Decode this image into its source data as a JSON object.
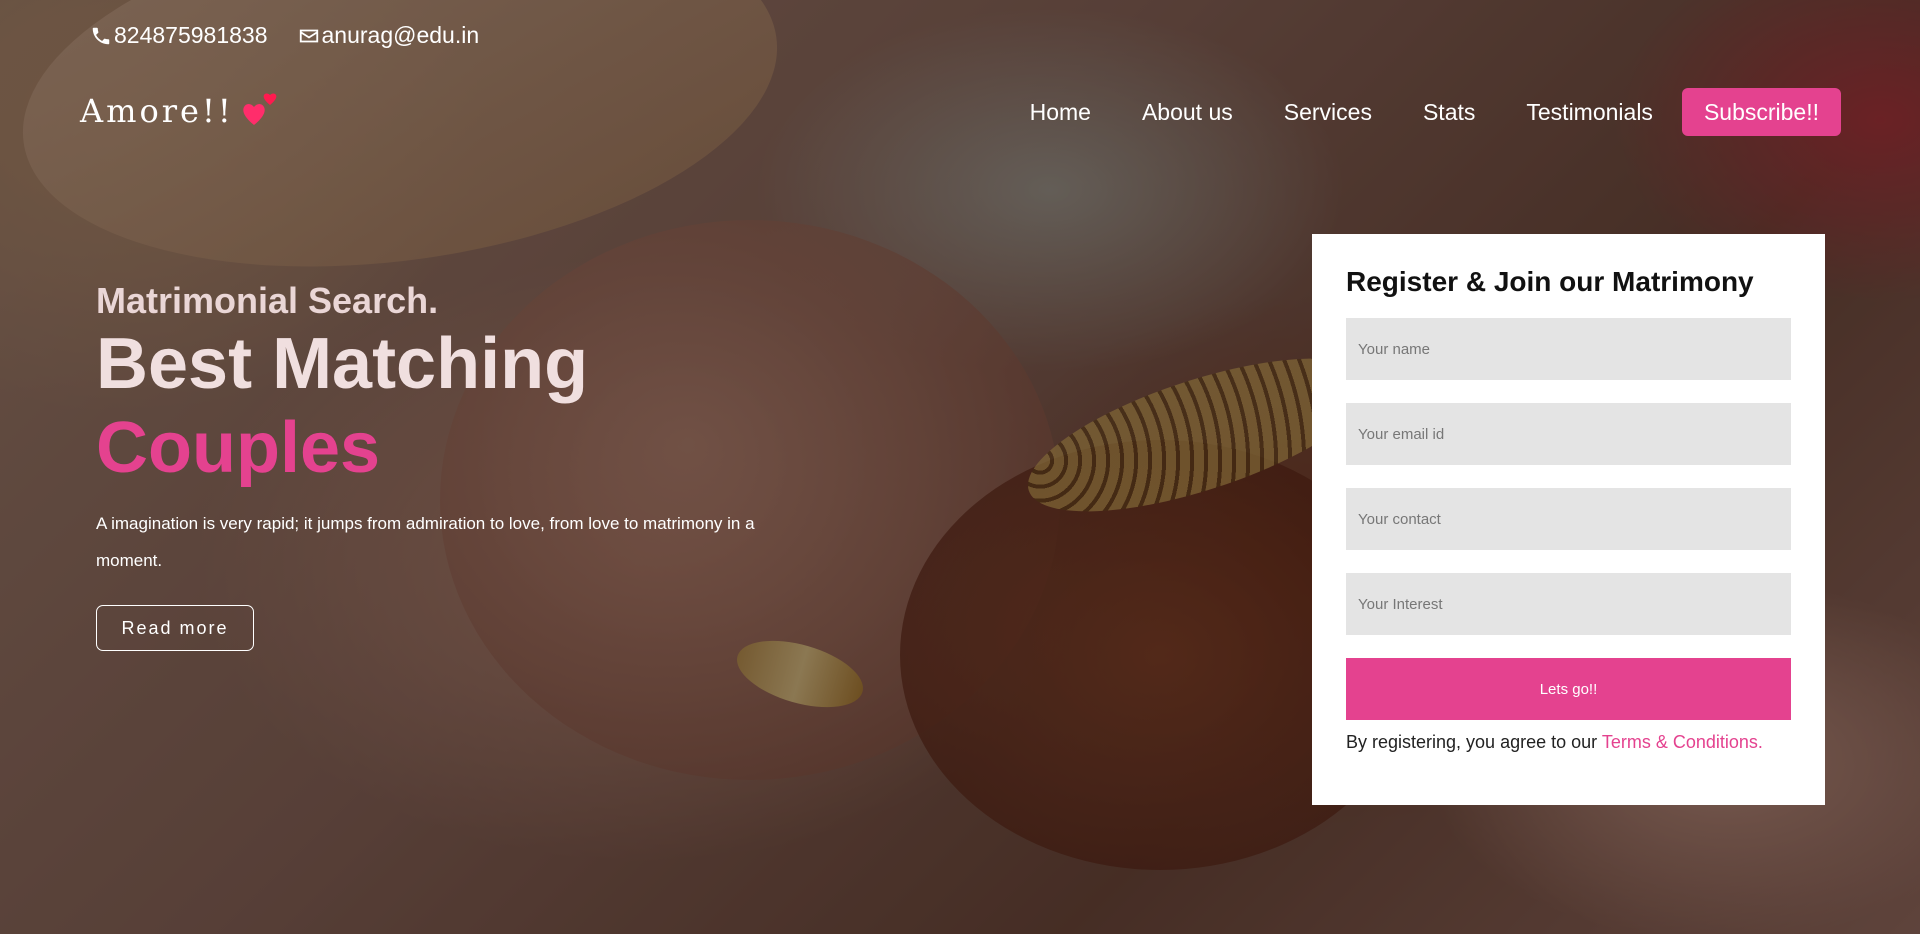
{
  "contact": {
    "phone": "824875981838",
    "email": "anurag@edu.in"
  },
  "brand": {
    "name": "Amore!!",
    "heart_icon": "double-heart-icon",
    "heart_colors": [
      "#ff2d6b",
      "#ff1a4f"
    ]
  },
  "nav": {
    "items": [
      {
        "label": "Home"
      },
      {
        "label": "About us"
      },
      {
        "label": "Services"
      },
      {
        "label": "Stats"
      },
      {
        "label": "Testimonials"
      }
    ],
    "subscribe_label": "Subscribe!!"
  },
  "hero": {
    "subtitle": "Matrimonial Search.",
    "headline_line1": "Best Matching",
    "headline_line2": "Couples",
    "description": "A imagination is very rapid; it jumps from admiration to love, from love to matrimony in a moment.",
    "read_more_label": "Read more"
  },
  "form": {
    "title": "Register & Join our Matrimony",
    "name_placeholder": "Your name",
    "email_placeholder": "Your email id",
    "contact_placeholder": "Your contact",
    "interest_placeholder": "Your Interest",
    "submit_label": "Lets go!!",
    "terms_prefix": "By registering, you agree to our",
    "terms_link": "Terms & Conditions."
  },
  "colors": {
    "accent": "#e4428f",
    "card_bg": "#ffffff",
    "input_bg": "#e4e4e4"
  }
}
